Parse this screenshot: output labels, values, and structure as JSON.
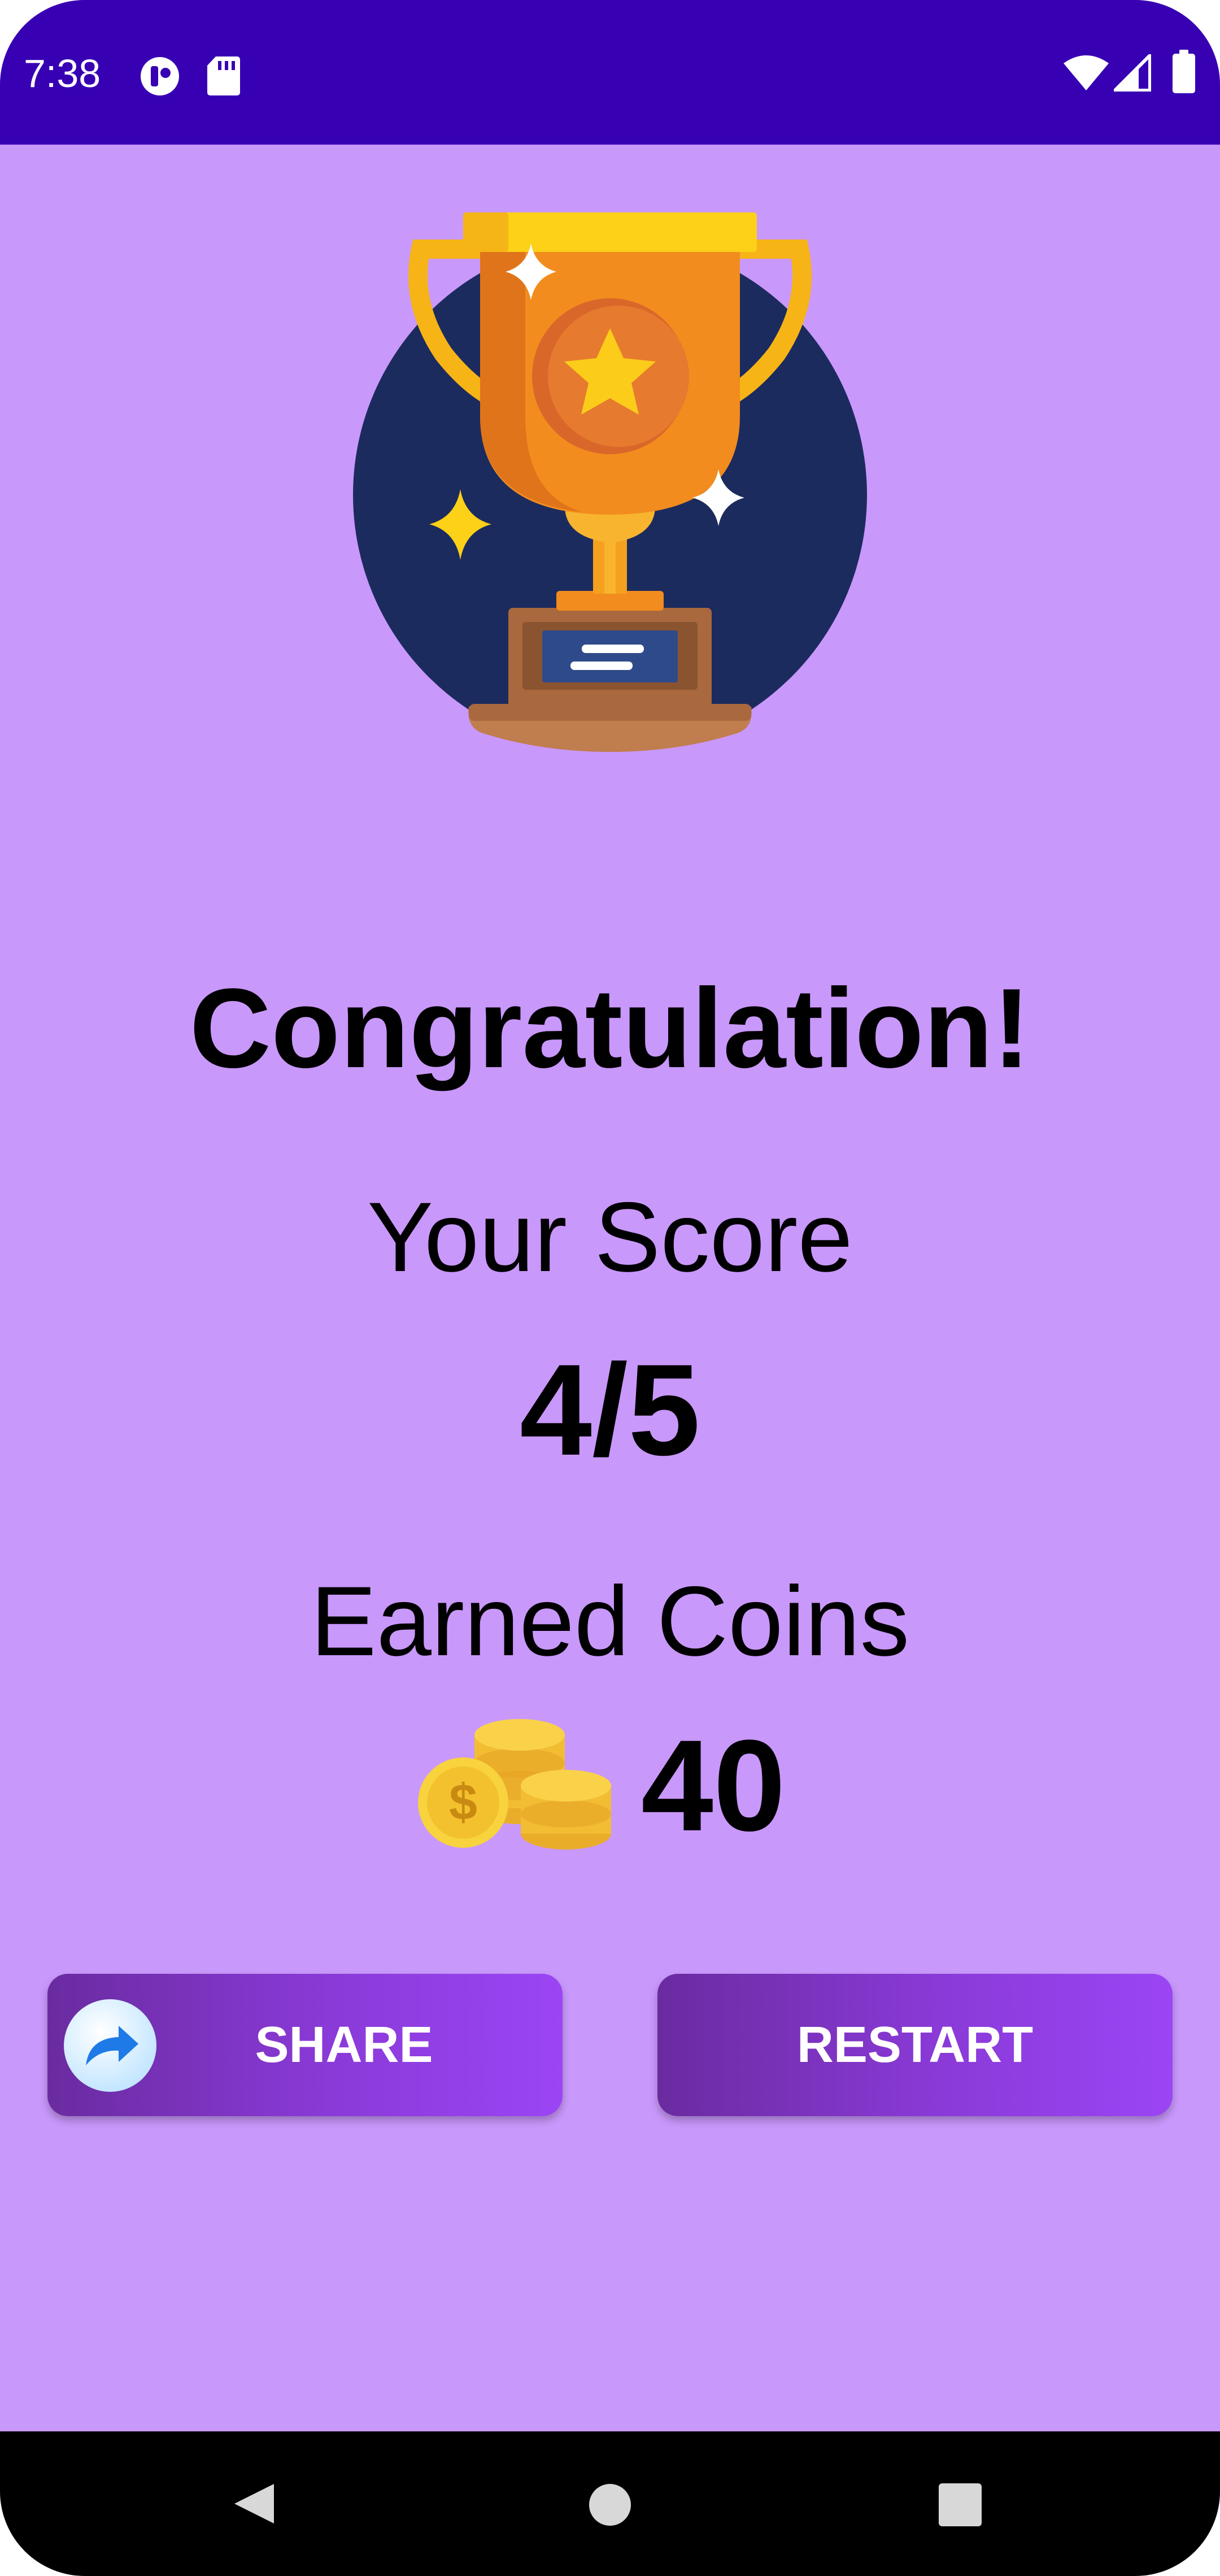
{
  "status_bar": {
    "time": "7:38",
    "icons": [
      "notification-app-icon",
      "sd-card-icon",
      "wifi-icon",
      "signal-icon",
      "battery-icon"
    ]
  },
  "result": {
    "image": "trophy-icon",
    "title": "Congratulation!",
    "score_label": "Your Score",
    "score_value": "4/5",
    "coins_label": "Earned Coins",
    "coins_icon": "coins-icon",
    "coins_value": "40"
  },
  "actions": {
    "share_label": "SHARE",
    "share_icon": "share-arrow-icon",
    "restart_label": "RESTART"
  },
  "nav_bar": {
    "buttons": [
      "back-icon",
      "home-icon",
      "recents-icon"
    ]
  },
  "colors": {
    "status_bar": "#3800b3",
    "background": "#c998fb",
    "button_gradient_start": "#6a2ba0",
    "button_gradient_end": "#9b45f5",
    "trophy_circle": "#1c2b5e"
  }
}
